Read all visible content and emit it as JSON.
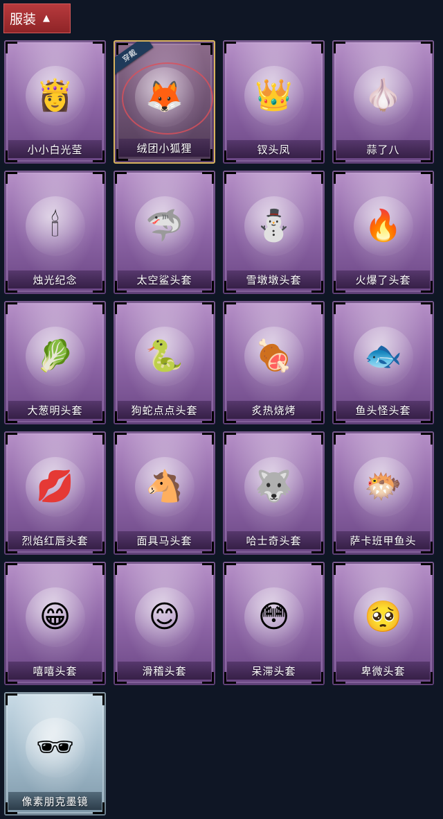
{
  "header": {
    "title": "服装",
    "chevron_icon": "chevron-up-icon"
  },
  "items": [
    {
      "label": "小小白光莹",
      "icon": "👸",
      "icon_name": "princess-avatar-icon",
      "rarity": "purple"
    },
    {
      "label": "绒团小狐狸",
      "icon": "🦊",
      "icon_name": "fox-avatar-icon",
      "rarity": "purple",
      "equipped": true,
      "badge": "穿戴"
    },
    {
      "label": "钗头凤",
      "icon": "👑",
      "icon_name": "phoenix-crown-icon",
      "rarity": "purple"
    },
    {
      "label": "蒜了八",
      "icon": "🧄",
      "icon_name": "garlic-avatar-icon",
      "rarity": "purple"
    },
    {
      "label": "烛光纪念",
      "icon": "🕯",
      "icon_name": "candle-avatar-icon",
      "rarity": "purple"
    },
    {
      "label": "太空鲨头套",
      "icon": "🦈",
      "icon_name": "shark-helmet-icon",
      "rarity": "purple"
    },
    {
      "label": "雪墩墩头套",
      "icon": "⛄",
      "icon_name": "snowman-helmet-icon",
      "rarity": "purple"
    },
    {
      "label": "火爆了头套",
      "icon": "🔥",
      "icon_name": "fire-helmet-icon",
      "rarity": "purple"
    },
    {
      "label": "大葱明头套",
      "icon": "🥬",
      "icon_name": "scallion-helmet-icon",
      "rarity": "purple"
    },
    {
      "label": "狗蛇点点头套",
      "icon": "🐍",
      "icon_name": "snake-helmet-icon",
      "rarity": "purple"
    },
    {
      "label": "炙热烧烤",
      "icon": "🍖",
      "icon_name": "bbq-helmet-icon",
      "rarity": "purple"
    },
    {
      "label": "鱼头怪头套",
      "icon": "🐟",
      "icon_name": "fishhead-helmet-icon",
      "rarity": "purple"
    },
    {
      "label": "烈焰红唇头套",
      "icon": "💋",
      "icon_name": "red-lips-helmet-icon",
      "rarity": "purple"
    },
    {
      "label": "面具马头套",
      "icon": "🐴",
      "icon_name": "horse-mask-icon",
      "rarity": "purple"
    },
    {
      "label": "哈士奇头套",
      "icon": "🐺",
      "icon_name": "husky-helmet-icon",
      "rarity": "purple"
    },
    {
      "label": "萨卡班甲鱼头",
      "icon": "🐡",
      "icon_name": "armored-fish-helmet-icon",
      "rarity": "purple"
    },
    {
      "label": "嘻嘻头套",
      "icon": "😁",
      "icon_name": "grin-emoji-helmet-icon",
      "rarity": "purple"
    },
    {
      "label": "滑稽头套",
      "icon": "😊",
      "icon_name": "funny-emoji-helmet-icon",
      "rarity": "purple"
    },
    {
      "label": "呆滞头套",
      "icon": "😳",
      "icon_name": "dazed-emoji-helmet-icon",
      "rarity": "purple"
    },
    {
      "label": "卑微头套",
      "icon": "🥺",
      "icon_name": "humble-emoji-helmet-icon",
      "rarity": "purple"
    },
    {
      "label": "像素朋克墨镜",
      "icon": "🕶",
      "icon_name": "pixel-sunglasses-icon",
      "rarity": "blue"
    }
  ]
}
